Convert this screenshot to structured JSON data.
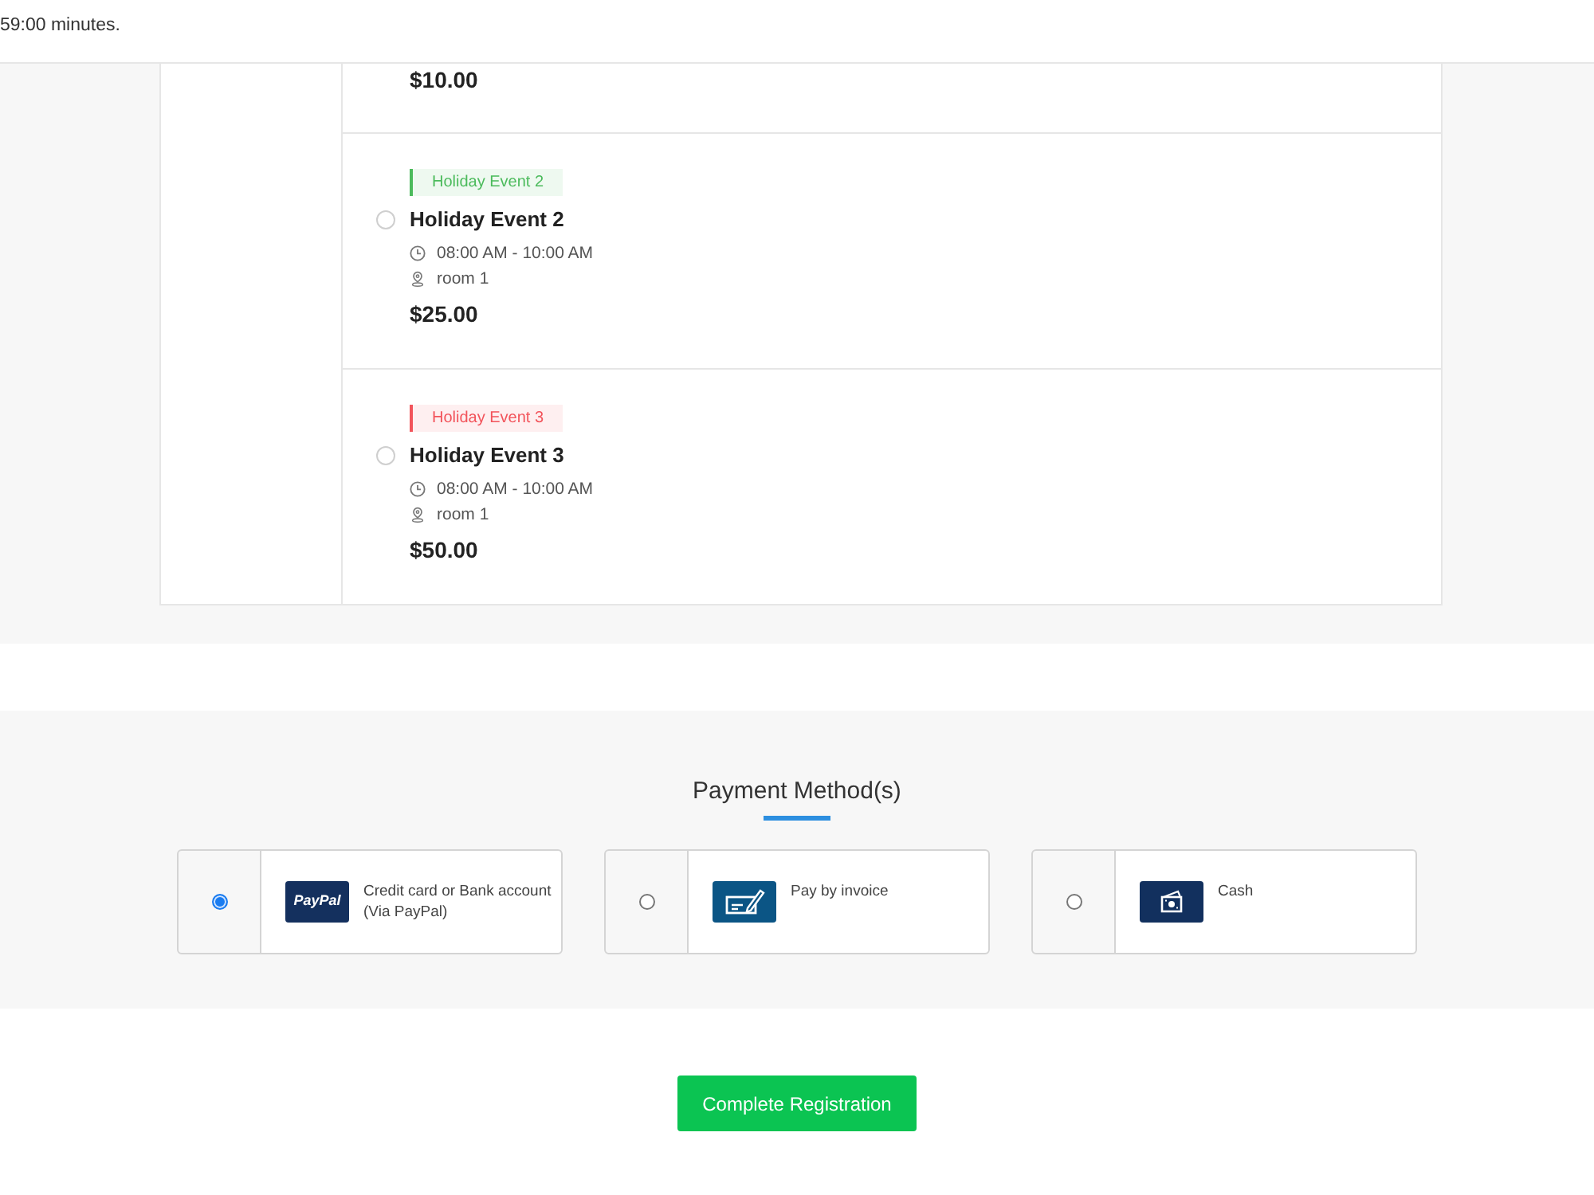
{
  "header": {
    "timer_text": "59:00 minutes."
  },
  "events": [
    {
      "price": "$10.00"
    },
    {
      "tag": {
        "label": "Holiday Event 2",
        "color": "#4cbb5c"
      },
      "title": "Holiday Event 2",
      "selected": false,
      "time": "08:00 AM - 10:00 AM",
      "location": "room 1",
      "price": "$25.00"
    },
    {
      "tag": {
        "label": "Holiday Event 3",
        "color": "#f2545b"
      },
      "title": "Holiday Event 3",
      "selected": false,
      "time": "08:00 AM - 10:00 AM",
      "location": "room 1",
      "price": "$50.00"
    }
  ],
  "payment": {
    "title": "Payment Method(s)",
    "methods": [
      {
        "kind": "paypal",
        "logo_text": "PayPal",
        "label": "Credit card or Bank account (Via PayPal)",
        "selected": true
      },
      {
        "kind": "invoice",
        "label": "Pay by invoice",
        "selected": false
      },
      {
        "kind": "cash",
        "label": "Cash",
        "selected": false
      }
    ]
  },
  "submit": {
    "label": "Complete Registration"
  }
}
